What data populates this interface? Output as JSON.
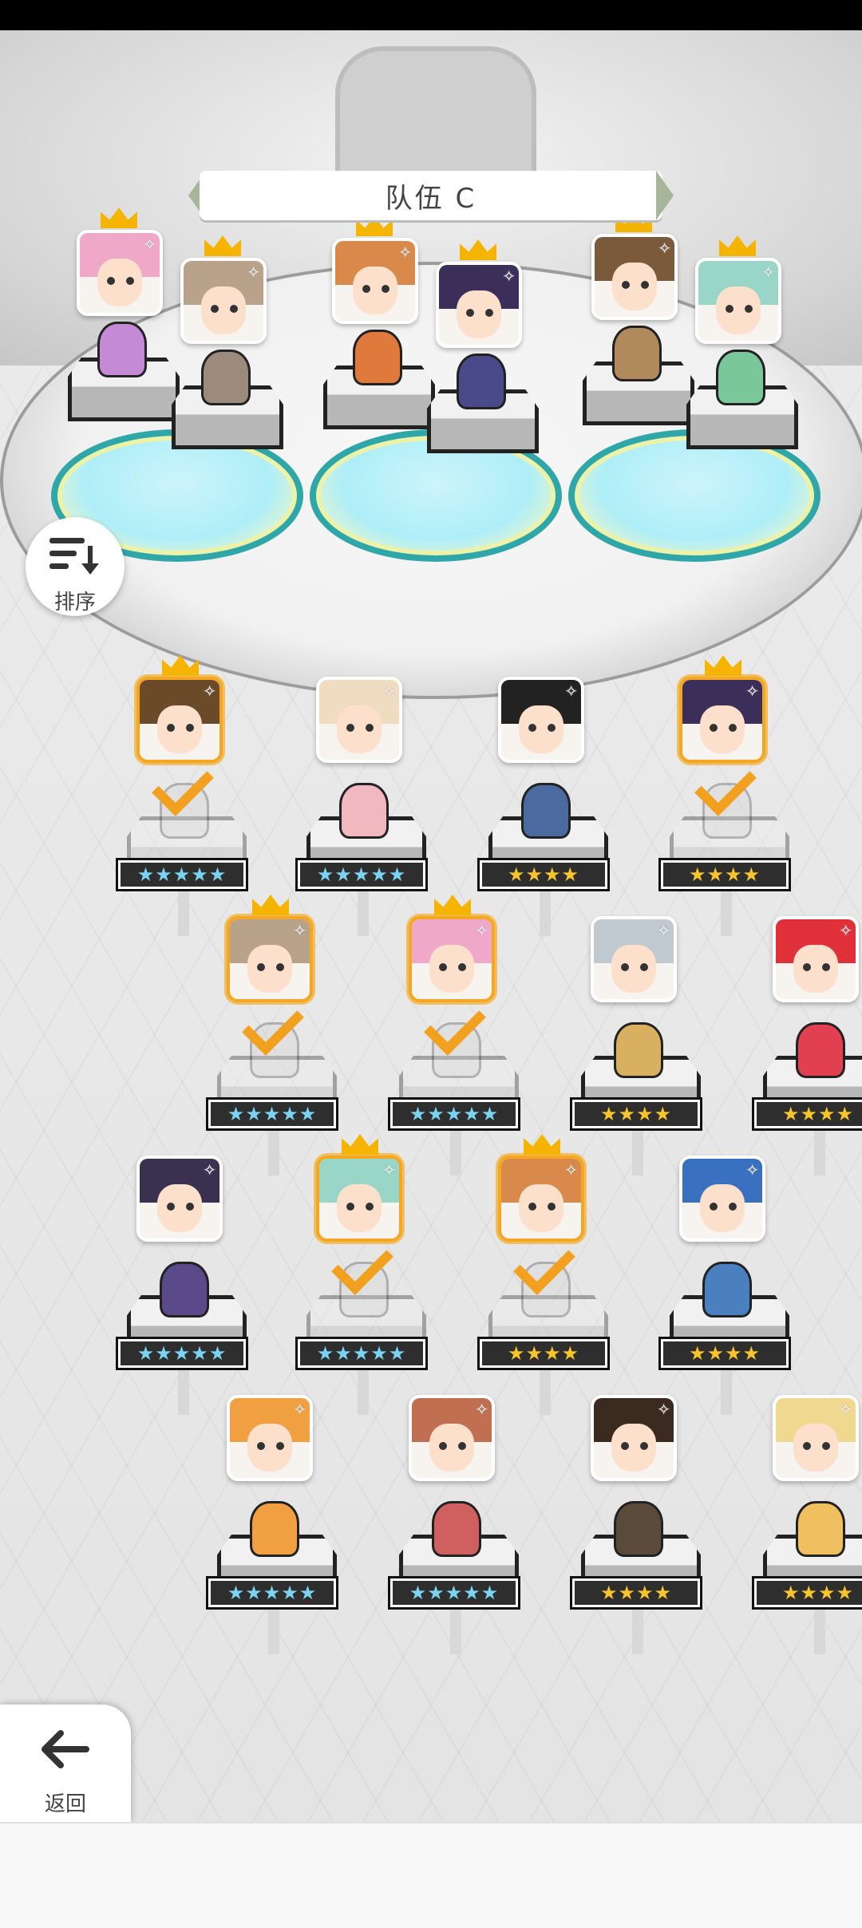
{
  "team": {
    "name": "队伍 C"
  },
  "buttons": {
    "sort_label": "排序",
    "back_label": "返回"
  },
  "team_slots": [
    {
      "hair": "#f0a8c8",
      "sprite": "#c58ad6"
    },
    {
      "hair": "#b8a38a",
      "sprite": "#9c8a7a"
    },
    {
      "hair": "#d98a4a",
      "sprite": "#e07a3c"
    },
    {
      "hair": "#3b2f5a",
      "sprite": "#4a4a8a"
    },
    {
      "hair": "#7a5a3a",
      "sprite": "#b08a5a"
    },
    {
      "hair": "#9ad6c8",
      "sprite": "#7ac89a"
    }
  ],
  "roster": [
    {
      "stars": "★★★★★",
      "tier": "five",
      "hair": "#6b4a2a",
      "sprite": "#cfcfcf",
      "selected": true,
      "in_team": true
    },
    {
      "stars": "★★★★★",
      "tier": "five",
      "hair": "#f0dcc0",
      "sprite": "#f2b8c0",
      "selected": false,
      "in_team": false
    },
    {
      "stars": "★★★★",
      "tier": "four",
      "hair": "#222",
      "sprite": "#4a6aa0",
      "selected": false,
      "in_team": false
    },
    {
      "stars": "★★★★",
      "tier": "four",
      "hair": "#3b2f5a",
      "sprite": "#cfcfcf",
      "selected": true,
      "in_team": true
    },
    {
      "stars": "★★★★★",
      "tier": "five",
      "hair": "#b8a38a",
      "sprite": "#cfcfcf",
      "selected": true,
      "in_team": true
    },
    {
      "stars": "★★★★★",
      "tier": "five",
      "hair": "#f0a8c8",
      "sprite": "#cfcfcf",
      "selected": true,
      "in_team": true
    },
    {
      "stars": "★★★★",
      "tier": "four",
      "hair": "#c0c8d0",
      "sprite": "#d8b060",
      "selected": false,
      "in_team": false
    },
    {
      "stars": "★★★★",
      "tier": "four",
      "hair": "#e0303a",
      "sprite": "#e04050",
      "selected": false,
      "in_team": false
    },
    {
      "stars": "★★★★★",
      "tier": "five",
      "hair": "#3a3050",
      "sprite": "#5a4a8a",
      "selected": false,
      "in_team": false
    },
    {
      "stars": "★★★★★",
      "tier": "five",
      "hair": "#9ad6c8",
      "sprite": "#cfcfcf",
      "selected": true,
      "in_team": true
    },
    {
      "stars": "★★★★",
      "tier": "four",
      "hair": "#d98a4a",
      "sprite": "#cfcfcf",
      "selected": true,
      "in_team": true
    },
    {
      "stars": "★★★★",
      "tier": "four",
      "hair": "#3a70c0",
      "sprite": "#4a80c0",
      "selected": false,
      "in_team": false
    },
    {
      "stars": "★★★★★",
      "tier": "five",
      "hair": "#f0a040",
      "sprite": "#f0a040",
      "selected": false,
      "in_team": false
    },
    {
      "stars": "★★★★★",
      "tier": "five",
      "hair": "#c07050",
      "sprite": "#d06060",
      "selected": false,
      "in_team": false
    },
    {
      "stars": "★★★★",
      "tier": "four",
      "hair": "#3a2a20",
      "sprite": "#5a4a3a",
      "selected": false,
      "in_team": false
    },
    {
      "stars": "★★★★",
      "tier": "four",
      "hair": "#f0d890",
      "sprite": "#f0c060",
      "selected": false,
      "in_team": false
    }
  ]
}
